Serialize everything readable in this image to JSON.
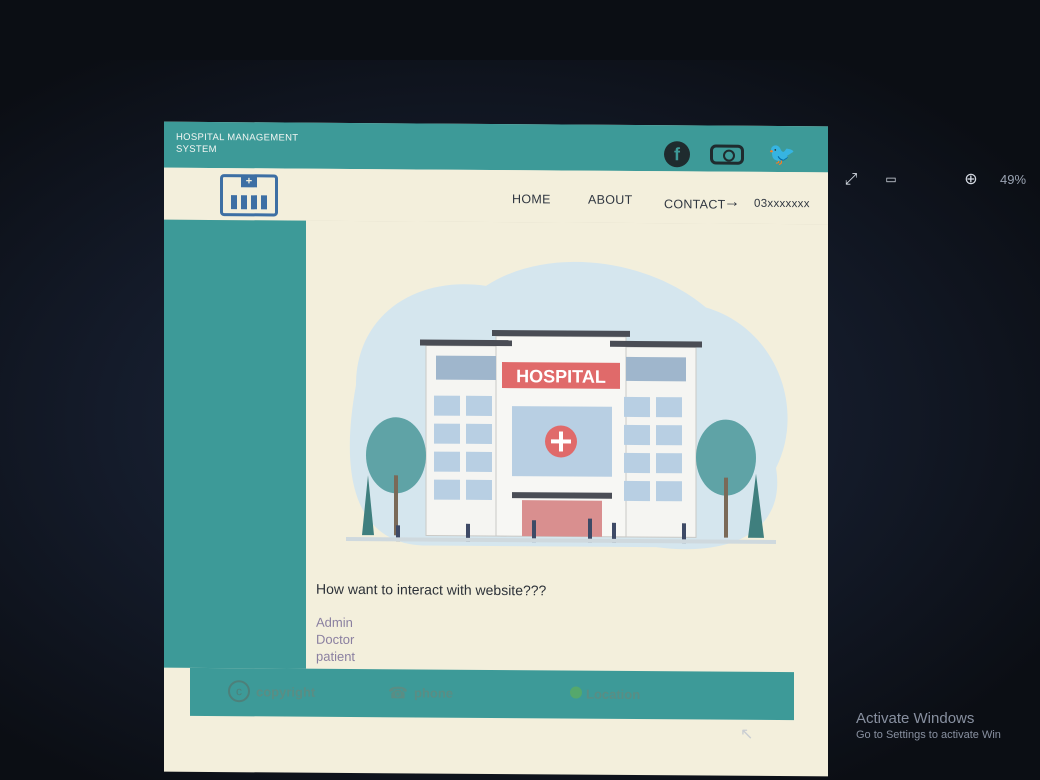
{
  "viewer": {
    "icons": [
      "edit-icon",
      "rotate-icon",
      "trash-icon",
      "info-icon",
      "share-icon",
      "more-icon",
      "expand-icon",
      "actual-size-icon",
      "zoom-in-icon"
    ],
    "zoom": "49%"
  },
  "site": {
    "brand_line1": "HOSPITAL MANAGEMENT",
    "brand_line2": "SYSTEM",
    "social": [
      "facebook-icon",
      "instagram-icon",
      "twitter-icon"
    ],
    "nav": {
      "home": "HOME",
      "about": "ABOUT",
      "contact": "CONTACT",
      "arrow": "→",
      "phone_number": "03xxxxxxx"
    },
    "hero": {
      "sign": "HOSPITAL"
    },
    "question": "How want to interact with website???",
    "roles": [
      "Admin",
      "Doctor",
      "patient"
    ],
    "footer": {
      "copyright": "copyright",
      "copyright_symbol": "c",
      "phone": "phone",
      "location": "Location"
    }
  },
  "os": {
    "activate_title": "Activate Windows",
    "activate_sub": "Go to Settings to activate Win"
  },
  "colors": {
    "teal": "#3d9a98",
    "cream": "#f3efdc",
    "logo_blue": "#3d6fa4",
    "sign_red": "#e06a6a"
  }
}
